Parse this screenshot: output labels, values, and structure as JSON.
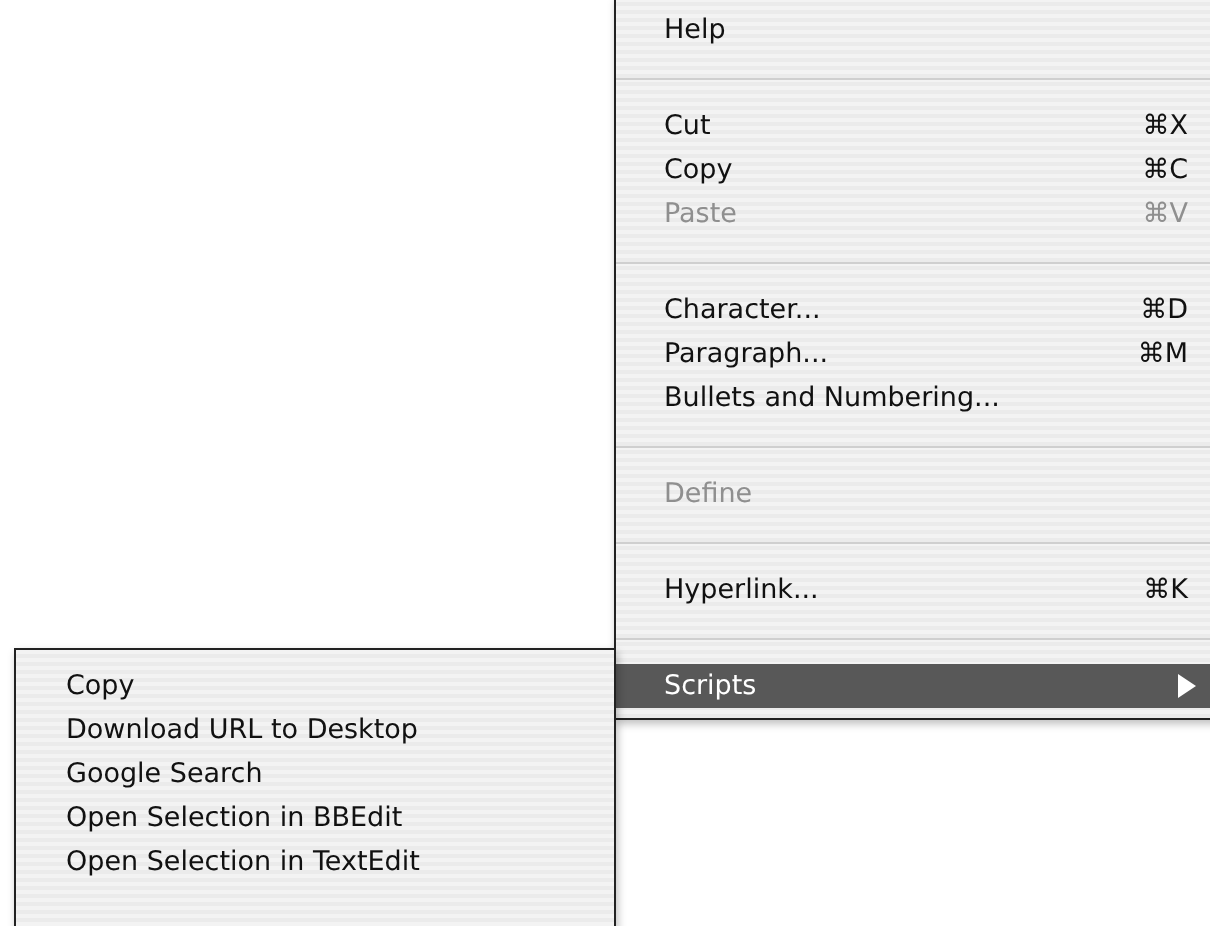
{
  "menu": {
    "items": [
      {
        "kind": "item",
        "label": "Help",
        "disabled": false,
        "selected": false,
        "submenu": false
      },
      {
        "kind": "separator"
      },
      {
        "kind": "item",
        "label": "Cut",
        "shortcut": "⌘X",
        "disabled": false,
        "selected": false,
        "submenu": false
      },
      {
        "kind": "item",
        "label": "Copy",
        "shortcut": "⌘C",
        "disabled": false,
        "selected": false,
        "submenu": false
      },
      {
        "kind": "item",
        "label": "Paste",
        "shortcut": "⌘V",
        "disabled": true,
        "selected": false,
        "submenu": false
      },
      {
        "kind": "separator"
      },
      {
        "kind": "item",
        "label": "Character...",
        "shortcut": "⌘D",
        "disabled": false,
        "selected": false,
        "submenu": false
      },
      {
        "kind": "item",
        "label": "Paragraph...",
        "shortcut": "⌘M",
        "disabled": false,
        "selected": false,
        "submenu": false
      },
      {
        "kind": "item",
        "label": "Bullets and Numbering...",
        "disabled": false,
        "selected": false,
        "submenu": false
      },
      {
        "kind": "separator"
      },
      {
        "kind": "item",
        "label": "Define",
        "disabled": true,
        "selected": false,
        "submenu": false
      },
      {
        "kind": "separator"
      },
      {
        "kind": "item",
        "label": "Hyperlink...",
        "shortcut": "⌘K",
        "disabled": false,
        "selected": false,
        "submenu": false
      },
      {
        "kind": "separator"
      },
      {
        "kind": "item",
        "label": "Scripts",
        "disabled": false,
        "selected": true,
        "submenu": true
      }
    ]
  },
  "submenu": {
    "items": [
      {
        "label": "Copy"
      },
      {
        "label": "Download URL to Desktop"
      },
      {
        "label": "Google Search"
      },
      {
        "label": "Open Selection in BBEdit"
      },
      {
        "label": "Open Selection in TextEdit"
      }
    ]
  }
}
